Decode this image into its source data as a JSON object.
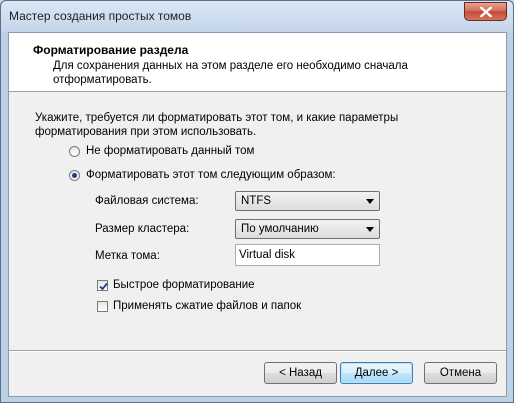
{
  "window": {
    "title": "Мастер создания простых томов"
  },
  "header": {
    "title": "Форматирование раздела",
    "description": "Для сохранения данных на этом разделе его необходимо сначала отформатировать."
  },
  "main": {
    "intro": "Укажите, требуется ли форматировать этот том, и какие параметры форматирования при этом использовать.",
    "radio_no_format": "Не форматировать данный том",
    "radio_format": "Форматировать этот том следующим образом:",
    "filesystem_label": "Файловая система:",
    "filesystem_value": "NTFS",
    "cluster_label": "Размер кластера:",
    "cluster_value": "По умолчанию",
    "volume_label_label": "Метка тома:",
    "volume_label_value": "Virtual disk",
    "quick_format_label": "Быстрое форматирование",
    "compression_label": "Применять сжатие файлов и папок"
  },
  "footer": {
    "back_label": "< Назад",
    "next_label": "Далее >",
    "cancel_label": "Отмена"
  }
}
